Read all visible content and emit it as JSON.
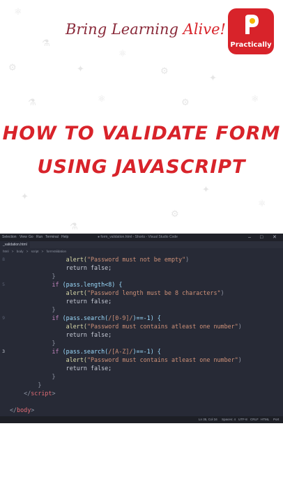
{
  "branding": {
    "tagline_main": "Bring Learning ",
    "tagline_accent": "Alive!",
    "logo_name": "Practically",
    "logo_icon": "practically-logo-icon"
  },
  "headline": {
    "line1": "HOW TO VALIDATE FORM",
    "line2": "USING JAVASCRIPT"
  },
  "editor": {
    "menu": [
      "Selection",
      "View",
      "Go",
      "Run",
      "Terminal",
      "Help"
    ],
    "window_title": "● form_validation.html - Shorts - Visual Studio Code",
    "tab_label": "_validation.html",
    "breadcrumb": [
      "html",
      ">",
      "body",
      ">",
      "script",
      ">",
      "formValidation"
    ],
    "gutter": [
      "8",
      "",
      "",
      "5",
      "",
      "",
      "",
      "9",
      "",
      "",
      "",
      "3",
      "",
      "",
      "",
      "",
      "",
      "",
      ""
    ],
    "lines": [
      {
        "parts": [
          {
            "t": "                alert(",
            "c": "fn"
          },
          {
            "t": "\"Password must not be empty\"",
            "c": "str"
          },
          {
            "t": ")",
            "c": "pun"
          }
        ]
      },
      {
        "parts": [
          {
            "t": "                return false;",
            "c": ""
          }
        ]
      },
      {
        "parts": [
          {
            "t": "            }",
            "c": "pun"
          }
        ]
      },
      {
        "parts": [
          {
            "t": "            if ",
            "c": "kw"
          },
          {
            "t": "(pass.length<8) {",
            "c": "var"
          }
        ]
      },
      {
        "parts": [
          {
            "t": "                alert(",
            "c": "fn"
          },
          {
            "t": "\"Password length must be 8 characters\"",
            "c": "str"
          },
          {
            "t": ")",
            "c": "pun"
          }
        ]
      },
      {
        "parts": [
          {
            "t": "                return false;",
            "c": ""
          }
        ]
      },
      {
        "parts": [
          {
            "t": "            }",
            "c": "pun"
          }
        ]
      },
      {
        "parts": [
          {
            "t": "            if ",
            "c": "kw"
          },
          {
            "t": "(pass.search(",
            "c": "var"
          },
          {
            "t": "/[0-9]/",
            "c": "str"
          },
          {
            "t": ")==-1) {",
            "c": "var"
          }
        ]
      },
      {
        "parts": [
          {
            "t": "                alert(",
            "c": "fn"
          },
          {
            "t": "\"Password must contains atleast one number\"",
            "c": "str"
          },
          {
            "t": ")",
            "c": "pun"
          }
        ]
      },
      {
        "parts": [
          {
            "t": "                return false;",
            "c": ""
          }
        ]
      },
      {
        "parts": [
          {
            "t": "            }",
            "c": "pun"
          }
        ]
      },
      {
        "parts": [
          {
            "t": "            if ",
            "c": "kw"
          },
          {
            "t": "(pass.search(",
            "c": "var"
          },
          {
            "t": "/[A-Z]/",
            "c": "str"
          },
          {
            "t": ")==-1) {",
            "c": "var"
          }
        ]
      },
      {
        "parts": [
          {
            "t": "                alert(",
            "c": "fn"
          },
          {
            "t": "\"Password must contains atleast one number\"",
            "c": "str"
          },
          {
            "t": ")",
            "c": "pun"
          }
        ]
      },
      {
        "parts": [
          {
            "t": "                return false;",
            "c": ""
          }
        ]
      },
      {
        "parts": [
          {
            "t": "            }",
            "c": "pun"
          }
        ]
      },
      {
        "parts": [
          {
            "t": "        }",
            "c": "pun"
          }
        ]
      },
      {
        "parts": [
          {
            "t": "    </",
            "c": "pun"
          },
          {
            "t": "script",
            "c": "tag"
          },
          {
            "t": ">",
            "c": "pun"
          }
        ]
      },
      {
        "parts": [
          {
            "t": "",
            "c": ""
          }
        ]
      },
      {
        "parts": [
          {
            "t": "</",
            "c": "pun"
          },
          {
            "t": "body",
            "c": "tag"
          },
          {
            "t": ">",
            "c": "pun"
          }
        ]
      }
    ],
    "status": [
      "Ln 35, Col 34",
      "Spaces: 4",
      "UTF-8",
      "CRLF",
      "HTML",
      "Port"
    ]
  },
  "colors": {
    "brand_red": "#d8232a",
    "editor_bg": "#272a36"
  }
}
